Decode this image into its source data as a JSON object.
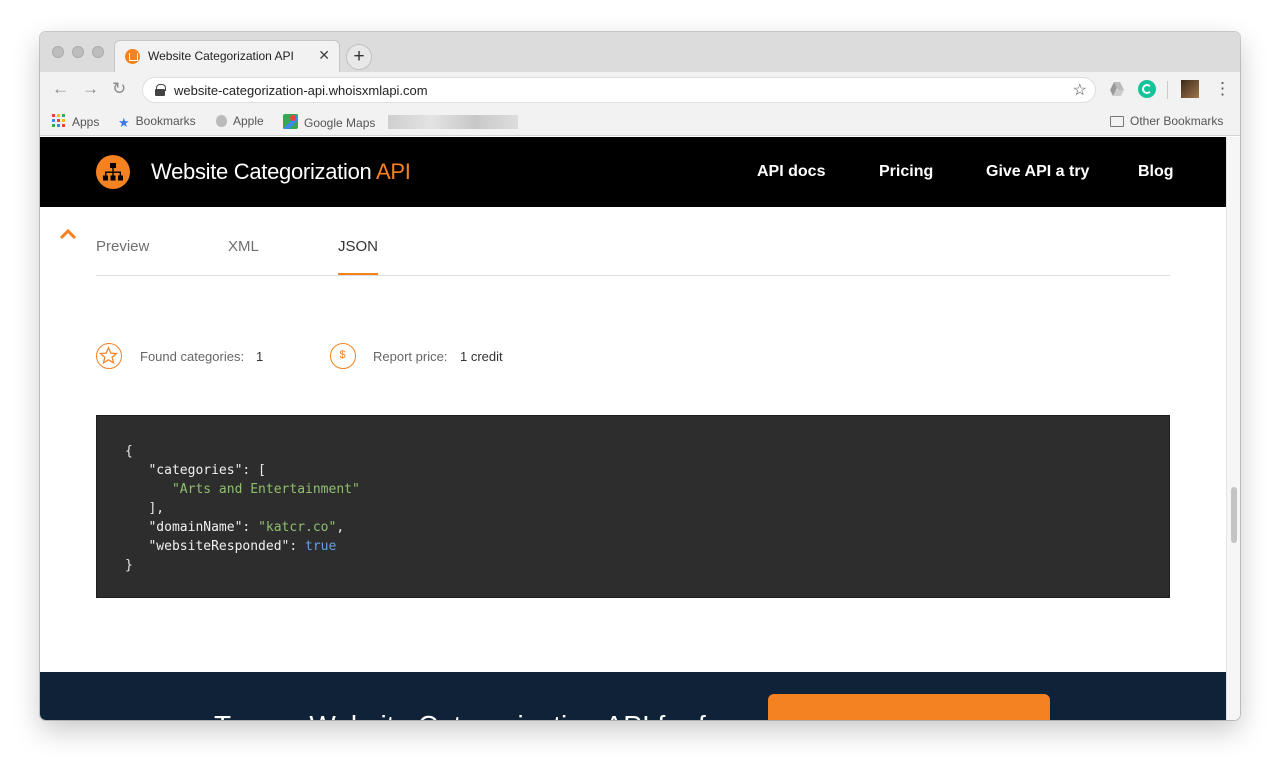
{
  "browser": {
    "tab_title": "Website Categorization API",
    "tab_close": "✕",
    "new_tab": "+",
    "url": "website-categorization-api.whoisxmlapi.com",
    "bookmarks": [
      "Apps",
      "Bookmarks",
      "Apple",
      "Google Maps"
    ],
    "other_bookmarks": "Other Bookmarks"
  },
  "site": {
    "brand_main": "Website Categorization ",
    "brand_accent": "API",
    "accent_color": "#f58220",
    "nav": [
      "API docs",
      "Pricing",
      "Give API a try",
      "Blog"
    ]
  },
  "result": {
    "tabs": [
      "Preview",
      "XML",
      "JSON"
    ],
    "active_tab": "JSON",
    "found_label": "Found categories:",
    "found_value": "1",
    "price_label": "Report price:",
    "price_value": "1 credit",
    "price_symbol": "$"
  },
  "code": {
    "open": "{",
    "categories_key": "\"categories\"",
    "categories_open": ": [",
    "category_value": "\"Arts and Entertainment\"",
    "categories_close": "],",
    "domain_key": "\"domainName\"",
    "domain_value": "\"katcr.co\"",
    "responded_key": "\"websiteResponded\"",
    "responded_value": "true",
    "close": "}"
  },
  "footer": {
    "text": "Try our Website Categorization API for free"
  }
}
